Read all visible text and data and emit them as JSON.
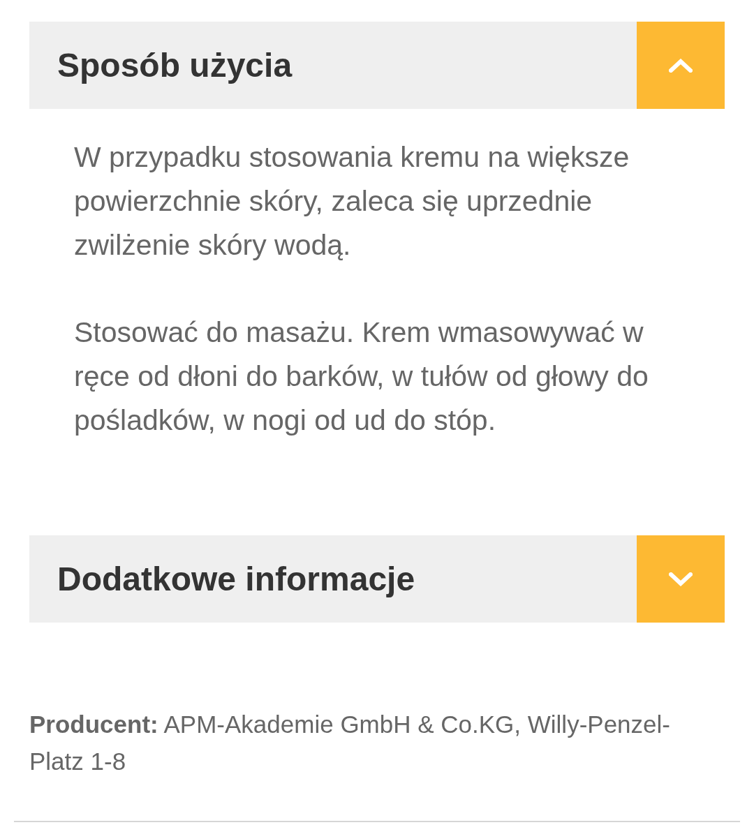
{
  "sections": [
    {
      "title": "Sposób użycia",
      "expanded": true,
      "paragraphs": [
        "W przypadku stosowania kremu na większe powierzchnie skóry, zaleca się uprzednie zwilżenie skóry wodą.",
        "Stosować do masażu. Krem wmasowywać w ręce od dłoni do barków, w tułów od głowy do pośladków, w nogi od ud do stóp."
      ]
    },
    {
      "title": "Dodatkowe informacje",
      "expanded": false
    }
  ],
  "producer": "**Producent:** APM-Akademie GmbH & Co.KG, Willy-Penzel-Platz 1-8"
}
